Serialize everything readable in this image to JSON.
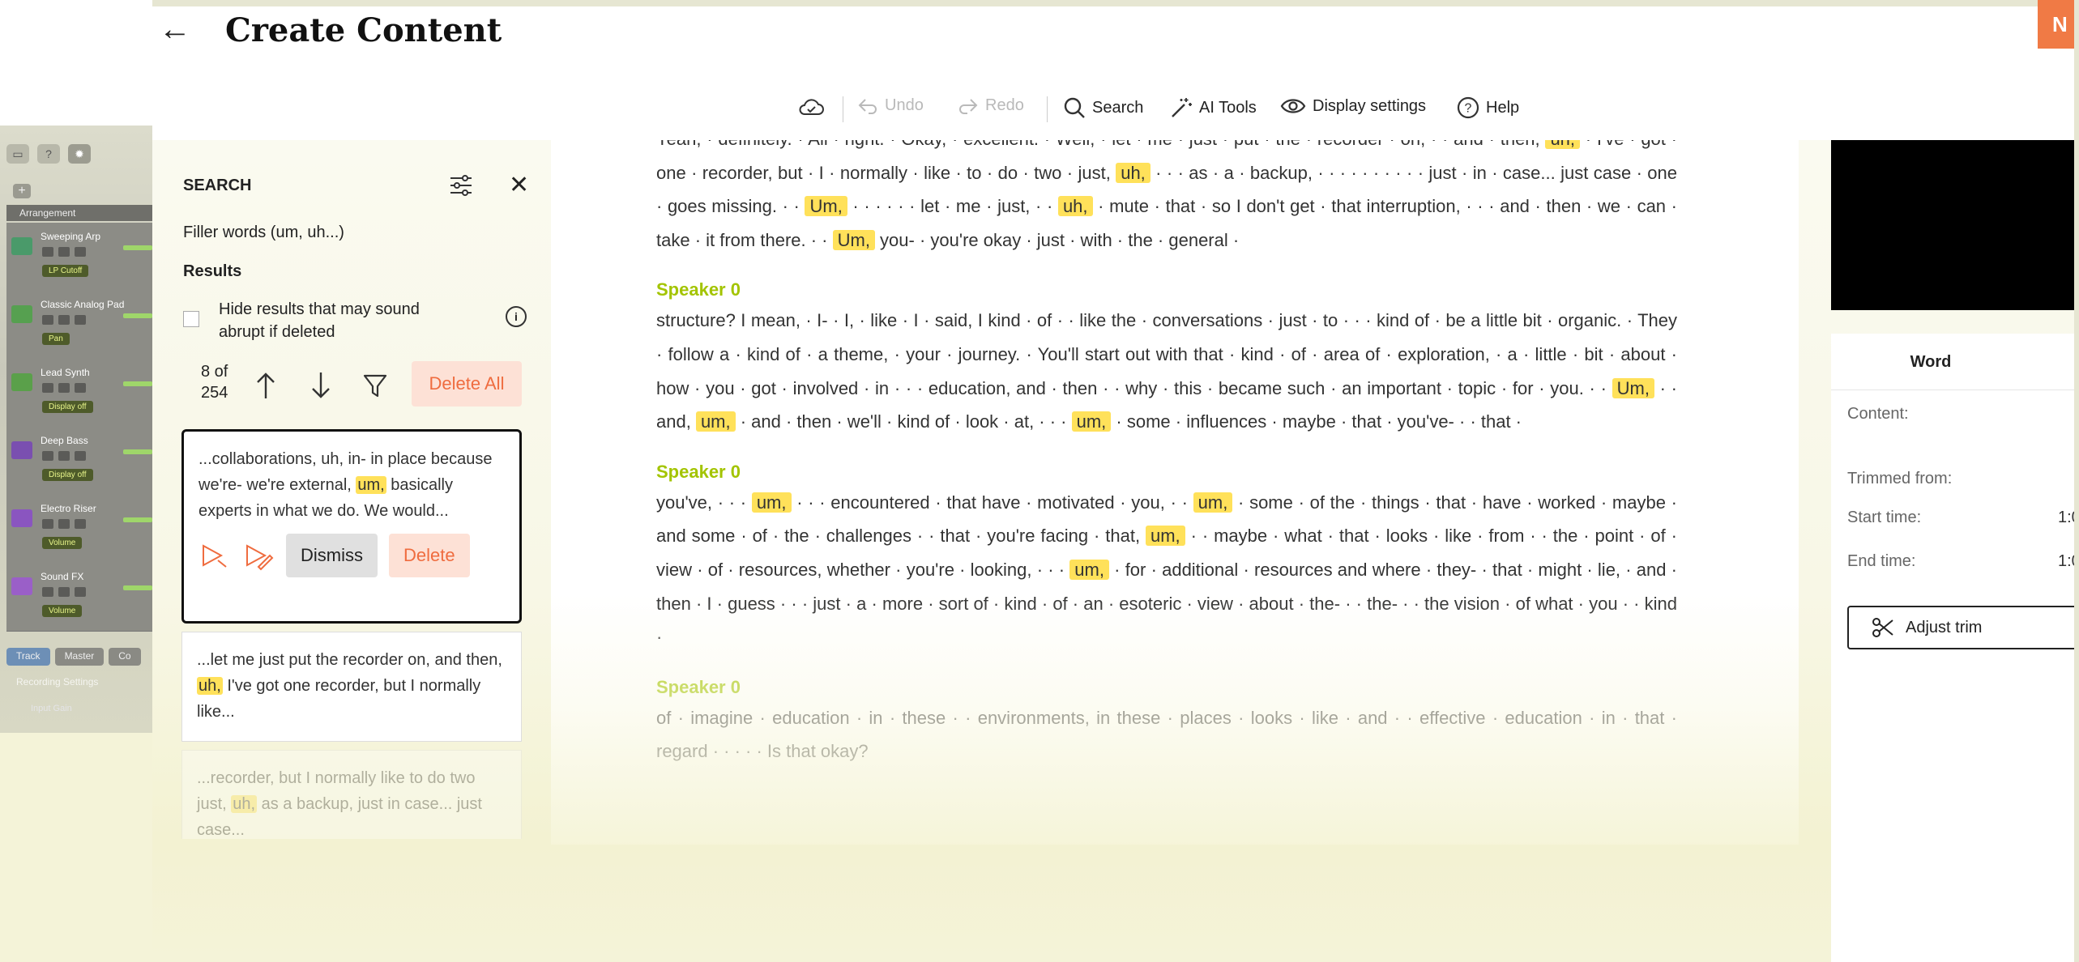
{
  "daw": {
    "section": "Arrangement",
    "tracks": [
      {
        "name": "Sweeping Arp",
        "badge": "LP Cutoff",
        "color": "#4a9a6a"
      },
      {
        "name": "Classic Analog Pad",
        "badge": "Pan",
        "color": "#56a050"
      },
      {
        "name": "Lead Synth",
        "badge": "Display off",
        "color": "#5aa04a"
      },
      {
        "name": "Deep Bass",
        "badge": "Display off",
        "color": "#7a4fb0"
      },
      {
        "name": "Electro Riser",
        "badge": "Volume",
        "color": "#8a55c0"
      },
      {
        "name": "Sound FX",
        "badge": "Volume",
        "color": "#9a5fc8"
      }
    ],
    "tabs": [
      "Track",
      "Master",
      "Co"
    ],
    "recording_settings": "Recording Settings",
    "input_gain": "Input Gain"
  },
  "header": {
    "title": "Create Content",
    "next_label": "N"
  },
  "toolbar": {
    "undo": "Undo",
    "redo": "Redo",
    "search": "Search",
    "ai_tools": "AI Tools",
    "display_settings": "Display settings",
    "help": "Help"
  },
  "search_panel": {
    "title": "SEARCH",
    "filter_label": "Filler words (um, uh...)",
    "results_heading": "Results",
    "hide_label": "Hide results that may sound abrupt if deleted",
    "count_line1": "8 of",
    "count_line2": "254",
    "delete_all": "Delete All",
    "dismiss": "Dismiss",
    "delete": "Delete",
    "results": [
      {
        "before": "...collaborations, uh, in- in place because we're- we're external, ",
        "match": "um,",
        "after": " basically experts in what we do. We would..."
      },
      {
        "before": "...let me just put the recorder on, and then, ",
        "match": "uh,",
        "after": " I've got one recorder, but I normally like..."
      },
      {
        "before": "...recorder, but I normally like to do two just, ",
        "match": "uh,",
        "after": " as a backup, just in case... just case..."
      }
    ]
  },
  "transcript": {
    "paragraphs": [
      {
        "speaker": "",
        "partial_top": true,
        "text": "Yeah, · definitely. · All · right. · Okay, · excellent. · Well, · let · me · just · put · the · recorder · on, · · and · then, [uh,] · I've · got · one · recorder, but · I · normally · like · to · do · two · just, [uh,] · · · as · a · backup, · · · · · · · · · · just · in · case... just case · one · goes missing. · · [Um,] · · · · · · let · me · just, · · [uh,] · mute · that · so I don't get · that interruption, · · · and · then · we · can · take · it from there. · · [Um,] you- · you're okay · just · with · the · general ·"
      },
      {
        "speaker": "Speaker 0",
        "text": "structure? I mean, · I- · I, · like · I · said, I kind · of · · like the · conversations · just · to · · · kind of · be a little bit · organic. · They · follow a · kind of · a theme, · your · journey. · You'll start out with that · kind · of · area of · exploration, · a · little · bit · about · how · you · got · involved · in · · · education, and · then · · why · this · became such · an important · topic · for · you. · · [Um,] · · and, [um,] · and · then · we'll · kind of · look · at, · · · [um,] · some · influences · maybe · that · you've- · · that ·"
      },
      {
        "speaker": "Speaker 0",
        "text": "you've, · · · [um,] · · · encountered · that have · motivated · you, · · [um,] · some · of the · things · that · have · worked · maybe · and some · of · the · challenges · · that · you're facing · that, [um,] · · maybe · what · that · looks · like · from · · the · point · of · view · of · resources, whether · you're · looking, · · · [um,] · for · additional · resources and where · they- · that · might · lie, · and · then · I · guess · · · just · a · more · sort of · kind · of · an · esoteric · view · about · the- · · the- · · the vision · of what · you · · kind ·"
      },
      {
        "speaker": "Speaker 0",
        "text": "of · imagine · education · in · these · · environments, in these · places · looks · like · and · · effective · education · in · that · regard · · · · · Is that okay?"
      }
    ]
  },
  "word_panel": {
    "title": "Word",
    "content_label": "Content:",
    "trimmed_label": "Trimmed from:",
    "start_label": "Start time:",
    "start_value": "1:0",
    "end_label": "End time:",
    "end_value": "1:0",
    "adjust_label": "Adjust trim"
  },
  "colors": {
    "accent": "#f07a45",
    "highlight": "#ffe15a",
    "speaker": "#a3c400"
  }
}
